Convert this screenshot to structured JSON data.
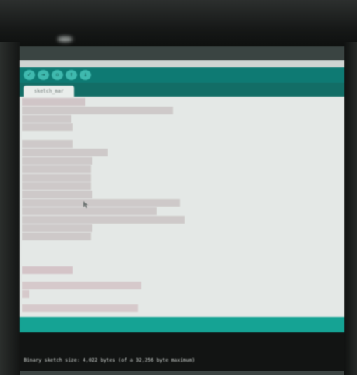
{
  "editor": {
    "tab_label": "sketch_mar"
  },
  "toolbar": {
    "buttons": [
      "verify",
      "upload",
      "new",
      "open",
      "save"
    ]
  },
  "console": {
    "status": "Binary sketch size: 4,022 bytes (of a 32,256 byte maximum)"
  }
}
